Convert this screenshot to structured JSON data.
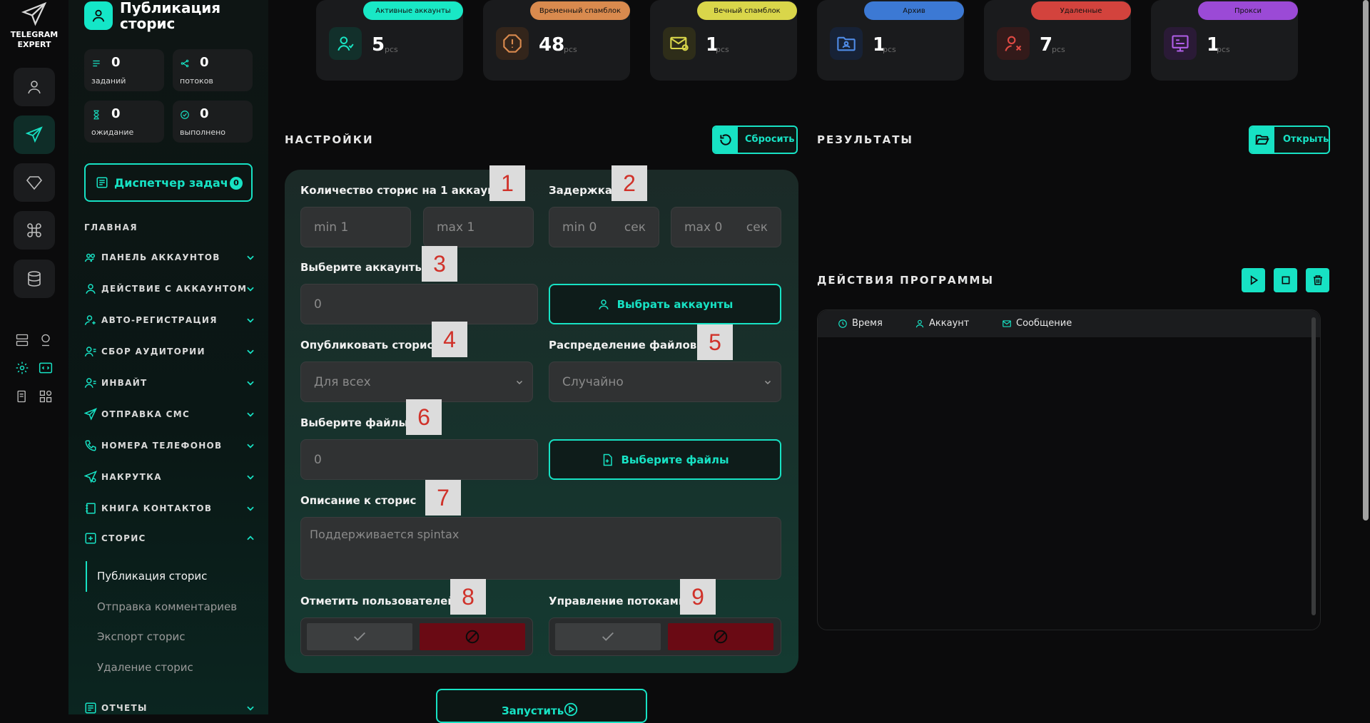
{
  "brand": {
    "name": "TELEGRAM\nEXPERT"
  },
  "page": {
    "title": "Публикация\nсторис"
  },
  "stats": [
    {
      "value": "0",
      "label": "заданий",
      "icon": "tasks-icon"
    },
    {
      "value": "0",
      "label": "потоков",
      "icon": "threads-icon"
    },
    {
      "value": "0",
      "label": "ожидание",
      "icon": "hourglass-icon"
    },
    {
      "value": "0",
      "label": "выполнено",
      "icon": "check-circle-icon"
    }
  ],
  "dispatcher": {
    "label": "Диспетчер задач",
    "count": "0"
  },
  "nav": {
    "section": "ГЛАВНАЯ",
    "items": [
      {
        "label": "ПАНЕЛЬ АККАУНТОВ"
      },
      {
        "label": "ДЕЙСТВИЕ С АККАУНТОМ"
      },
      {
        "label": "АВТО-РЕГИСТРАЦИЯ"
      },
      {
        "label": "СБОР АУДИТОРИИ"
      },
      {
        "label": "ИНВАЙТ"
      },
      {
        "label": "ОТПРАВКА СМС"
      },
      {
        "label": "НОМЕРА ТЕЛЕФОНОВ"
      },
      {
        "label": "НАКРУТКА"
      },
      {
        "label": "КНИГА КОНТАКТОВ"
      },
      {
        "label": "СТОРИС"
      }
    ],
    "sub": [
      {
        "label": "Публикация сторис"
      },
      {
        "label": "Отправка комментариев"
      },
      {
        "label": "Экспорт сторис"
      },
      {
        "label": "Удаление сторис"
      }
    ],
    "reports": "ОТЧЕТЫ"
  },
  "cards": [
    {
      "label": "Активные аккаунты",
      "value": "5",
      "unit": "pcs",
      "color": "#19e8c6"
    },
    {
      "label": "Временный спамблок",
      "value": "48",
      "unit": "pcs",
      "color": "#d98a4e"
    },
    {
      "label": "Вечный спамблок",
      "value": "1",
      "unit": "pcs",
      "color": "#d9d64a"
    },
    {
      "label": "Архив",
      "value": "1",
      "unit": "pcs",
      "color": "#3c79d4"
    },
    {
      "label": "Удаленные",
      "value": "7",
      "unit": "pcs",
      "color": "#d3433d"
    },
    {
      "label": "Прокси",
      "value": "1",
      "unit": "pcs",
      "color": "#9b4ad6"
    }
  ],
  "settings": {
    "title": "НАСТРОЙКИ",
    "reset": "Сбросить",
    "count_label": "Количество сторис на 1 аккаунт",
    "count_min": "min 1",
    "count_max": "max 1",
    "delay_label": "Задержка",
    "delay_min": "min 0",
    "delay_max": "max 0",
    "delay_unit": "сек",
    "accounts_label": "Выберите аккаунты",
    "accounts_value": "0",
    "accounts_btn": "Выбрать аккаунты",
    "publish_label": "Опубликовать сторис",
    "publish_value": "Для всех",
    "distribution_label": "Распределение файлов",
    "distribution_value": "Случайно",
    "files_label": "Выберите файлы",
    "files_value": "0",
    "files_btn": "Выберите файлы",
    "desc_label": "Описание к сторис",
    "desc_placeholder": "Поддерживается spintax",
    "mark_label": "Отметить пользователей",
    "threads_label": "Управление потоками",
    "run": "Запустить"
  },
  "markers": [
    "1",
    "2",
    "3",
    "4",
    "5",
    "6",
    "7",
    "8",
    "9"
  ],
  "results": {
    "title": "РЕЗУЛЬТАТЫ",
    "open": "Открыть"
  },
  "actions": {
    "title": "ДЕЙСТВИЯ ПРОГРАММЫ",
    "cols": [
      "Время",
      "Аккаунт",
      "Сообщение"
    ]
  },
  "accent": "#17e2c4"
}
